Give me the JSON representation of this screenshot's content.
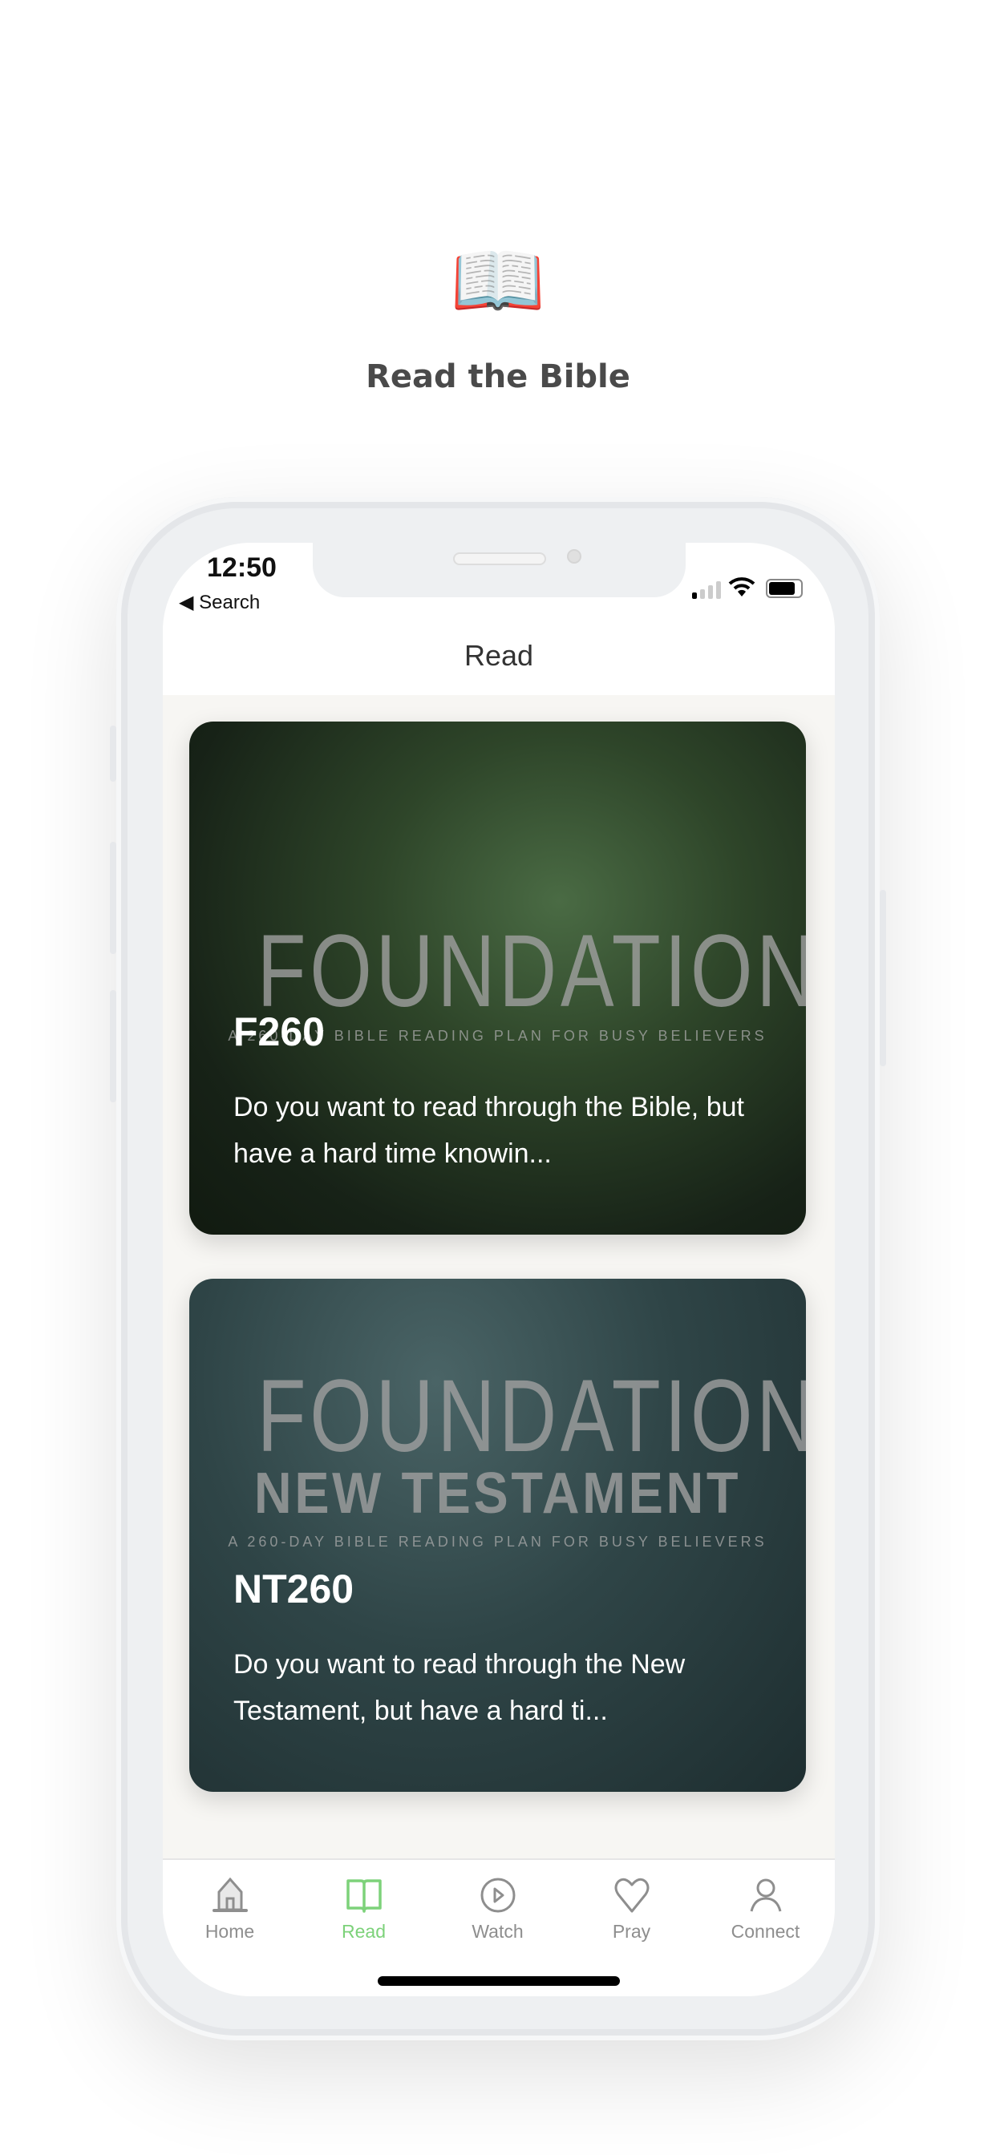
{
  "hero": {
    "icon": "open-book-emoji",
    "emoji": "📖",
    "title": "Read the Bible"
  },
  "status_bar": {
    "time": "12:50",
    "back_label": "◀ Search"
  },
  "header": {
    "title": "Read"
  },
  "plans": [
    {
      "cover_title": "FOUNDATIONS",
      "cover_subtitle": "A 260-DAY BIBLE READING PLAN FOR BUSY BELIEVERS",
      "code": "F260",
      "description": "Do you want to read through the Bible, but have a hard time knowin..."
    },
    {
      "cover_title": "FOUNDATIONS",
      "cover_title_2": "NEW TESTAMENT",
      "cover_subtitle": "A 260-DAY BIBLE READING PLAN FOR BUSY BELIEVERS",
      "code": "NT260",
      "description": "Do you want to read through the New Testament, but have a hard ti..."
    }
  ],
  "tabs": [
    {
      "label": "Home",
      "icon": "home-icon"
    },
    {
      "label": "Read",
      "icon": "book-icon",
      "active": true
    },
    {
      "label": "Watch",
      "icon": "play-circle-icon"
    },
    {
      "label": "Pray",
      "icon": "heart-icon"
    },
    {
      "label": "Connect",
      "icon": "person-icon"
    }
  ],
  "colors": {
    "accent": "#7dd27a",
    "inactive": "#8e8e8e",
    "background": "#f7f6f3"
  }
}
